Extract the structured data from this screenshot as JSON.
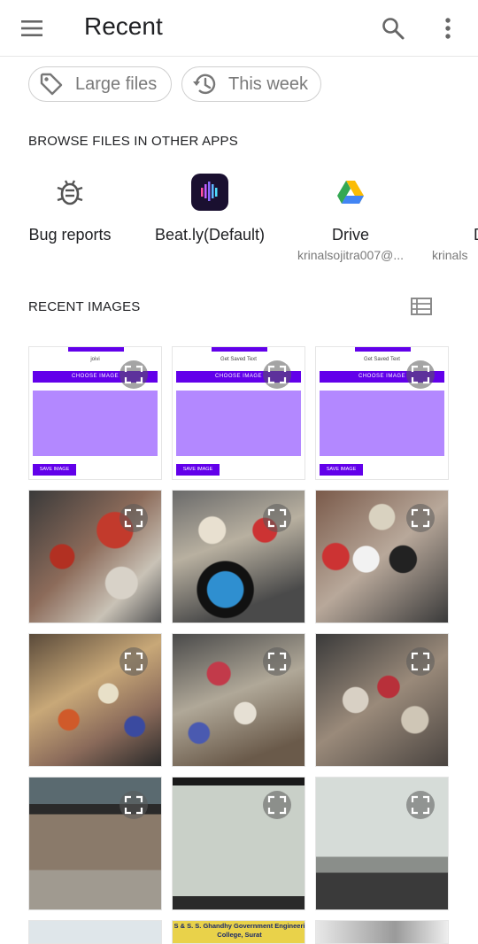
{
  "header": {
    "title": "Recent"
  },
  "chips": [
    {
      "label": "Large files"
    },
    {
      "label": "This week"
    }
  ],
  "browse_section": {
    "title": "BROWSE FILES IN OTHER APPS"
  },
  "apps": [
    {
      "name": "Bug reports",
      "sub": ""
    },
    {
      "name": "Beat.ly(Default)",
      "sub": ""
    },
    {
      "name": "Drive",
      "sub": "krinalsojitra007@..."
    },
    {
      "name": "D",
      "sub": "krinals"
    }
  ],
  "recent_images": {
    "title": "RECENT IMAGES"
  },
  "screenshots": [
    {
      "caption": "joivi",
      "choose": "CHOOSE IMAGE",
      "save": "SAVE IMAGE"
    },
    {
      "caption": "Get Saved Text",
      "choose": "CHOOSE IMAGE",
      "save": "SAVE IMAGE"
    },
    {
      "caption": "Get Saved Text",
      "choose": "CHOOSE IMAGE",
      "save": "SAVE IMAGE"
    }
  ],
  "bottom_partial": {
    "text1": "S & S. S. Ghandhy Government Engineeri",
    "text2": "College, Surat"
  },
  "colors": {
    "accent": "#6200ea",
    "panel": "#b388ff",
    "muted": "#7a7a7a"
  }
}
